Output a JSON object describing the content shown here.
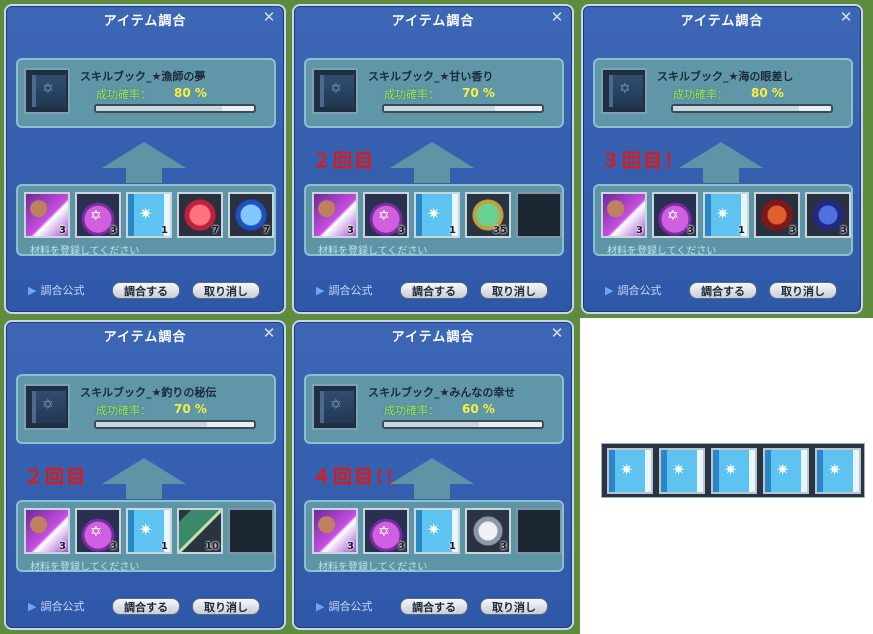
{
  "panels": [
    {
      "title": "アイテム調合",
      "recipe": "スキルブック_★漁師の夢",
      "rate_label": "成功確率：",
      "rate_value": "80 %",
      "rate_pct": 80,
      "attempt": "",
      "slots": [
        {
          "icon": "purple-weapon-icon",
          "count": "3"
        },
        {
          "icon": "magic-potion-icon",
          "count": "3"
        },
        {
          "icon": "skill-book-icon",
          "count": "1"
        },
        {
          "icon": "red-crystal-icon",
          "count": "7"
        },
        {
          "icon": "blue-crystal-icon",
          "count": "7"
        }
      ],
      "hint": "材料を登録してください",
      "formula_label": "調合公式",
      "craft_label": "調合する",
      "cancel_label": "取り消し"
    },
    {
      "title": "アイテム調合",
      "recipe": "スキルブック_★甘い香り",
      "rate_label": "成功確率：",
      "rate_value": "70 %",
      "rate_pct": 70,
      "attempt": "２回目",
      "slots": [
        {
          "icon": "purple-weapon-icon",
          "count": "3"
        },
        {
          "icon": "magic-potion-icon",
          "count": "3"
        },
        {
          "icon": "skill-book-icon",
          "count": "1"
        },
        {
          "icon": "green-gem-icon",
          "count": "35"
        },
        {
          "icon": "empty",
          "count": ""
        }
      ],
      "hint": "材料を登録してください",
      "formula_label": "調合公式",
      "craft_label": "調合する",
      "cancel_label": "取り消し"
    },
    {
      "title": "アイテム調合",
      "recipe": "スキルブック_★海の眼差し",
      "rate_label": "成功確率：",
      "rate_value": "80 %",
      "rate_pct": 80,
      "attempt": "３回目！",
      "slots": [
        {
          "icon": "purple-weapon-icon",
          "count": "3"
        },
        {
          "icon": "magic-potion-icon",
          "count": "3"
        },
        {
          "icon": "skill-book-icon",
          "count": "1"
        },
        {
          "icon": "red-gem-icon",
          "count": "3"
        },
        {
          "icon": "blue-gem-icon",
          "count": "3"
        }
      ],
      "hint": "材料を登録してください",
      "formula_label": "調合公式",
      "craft_label": "調合する",
      "cancel_label": "取り消し"
    },
    {
      "title": "アイテム調合",
      "recipe": "スキルブック_★釣りの秘伝",
      "rate_label": "成功確率：",
      "rate_value": "70 %",
      "rate_pct": 70,
      "attempt": "２回目",
      "slots": [
        {
          "icon": "purple-weapon-icon",
          "count": "3"
        },
        {
          "icon": "magic-potion-icon",
          "count": "3"
        },
        {
          "icon": "skill-book-icon",
          "count": "1"
        },
        {
          "icon": "green-stone-icon",
          "count": "10"
        },
        {
          "icon": "empty",
          "count": ""
        }
      ],
      "hint": "材料を登録してください",
      "formula_label": "調合公式",
      "craft_label": "調合する",
      "cancel_label": "取り消し"
    },
    {
      "title": "アイテム調合",
      "recipe": "スキルブック_★みんなの幸せ",
      "rate_label": "成功確率：",
      "rate_value": "60 %",
      "rate_pct": 60,
      "attempt": "４回目!!",
      "slots": [
        {
          "icon": "purple-weapon-icon",
          "count": "3"
        },
        {
          "icon": "magic-potion-icon",
          "count": "3"
        },
        {
          "icon": "skill-book-icon",
          "count": "1"
        },
        {
          "icon": "silver-ore-icon",
          "count": "3"
        },
        {
          "icon": "empty",
          "count": ""
        }
      ],
      "hint": "材料を登録してください",
      "formula_label": "調合公式",
      "craft_label": "調合する",
      "cancel_label": "取り消し"
    }
  ],
  "result_books": [
    "skill-book-icon",
    "skill-book-icon",
    "skill-book-icon",
    "skill-book-icon",
    "skill-book-icon"
  ]
}
